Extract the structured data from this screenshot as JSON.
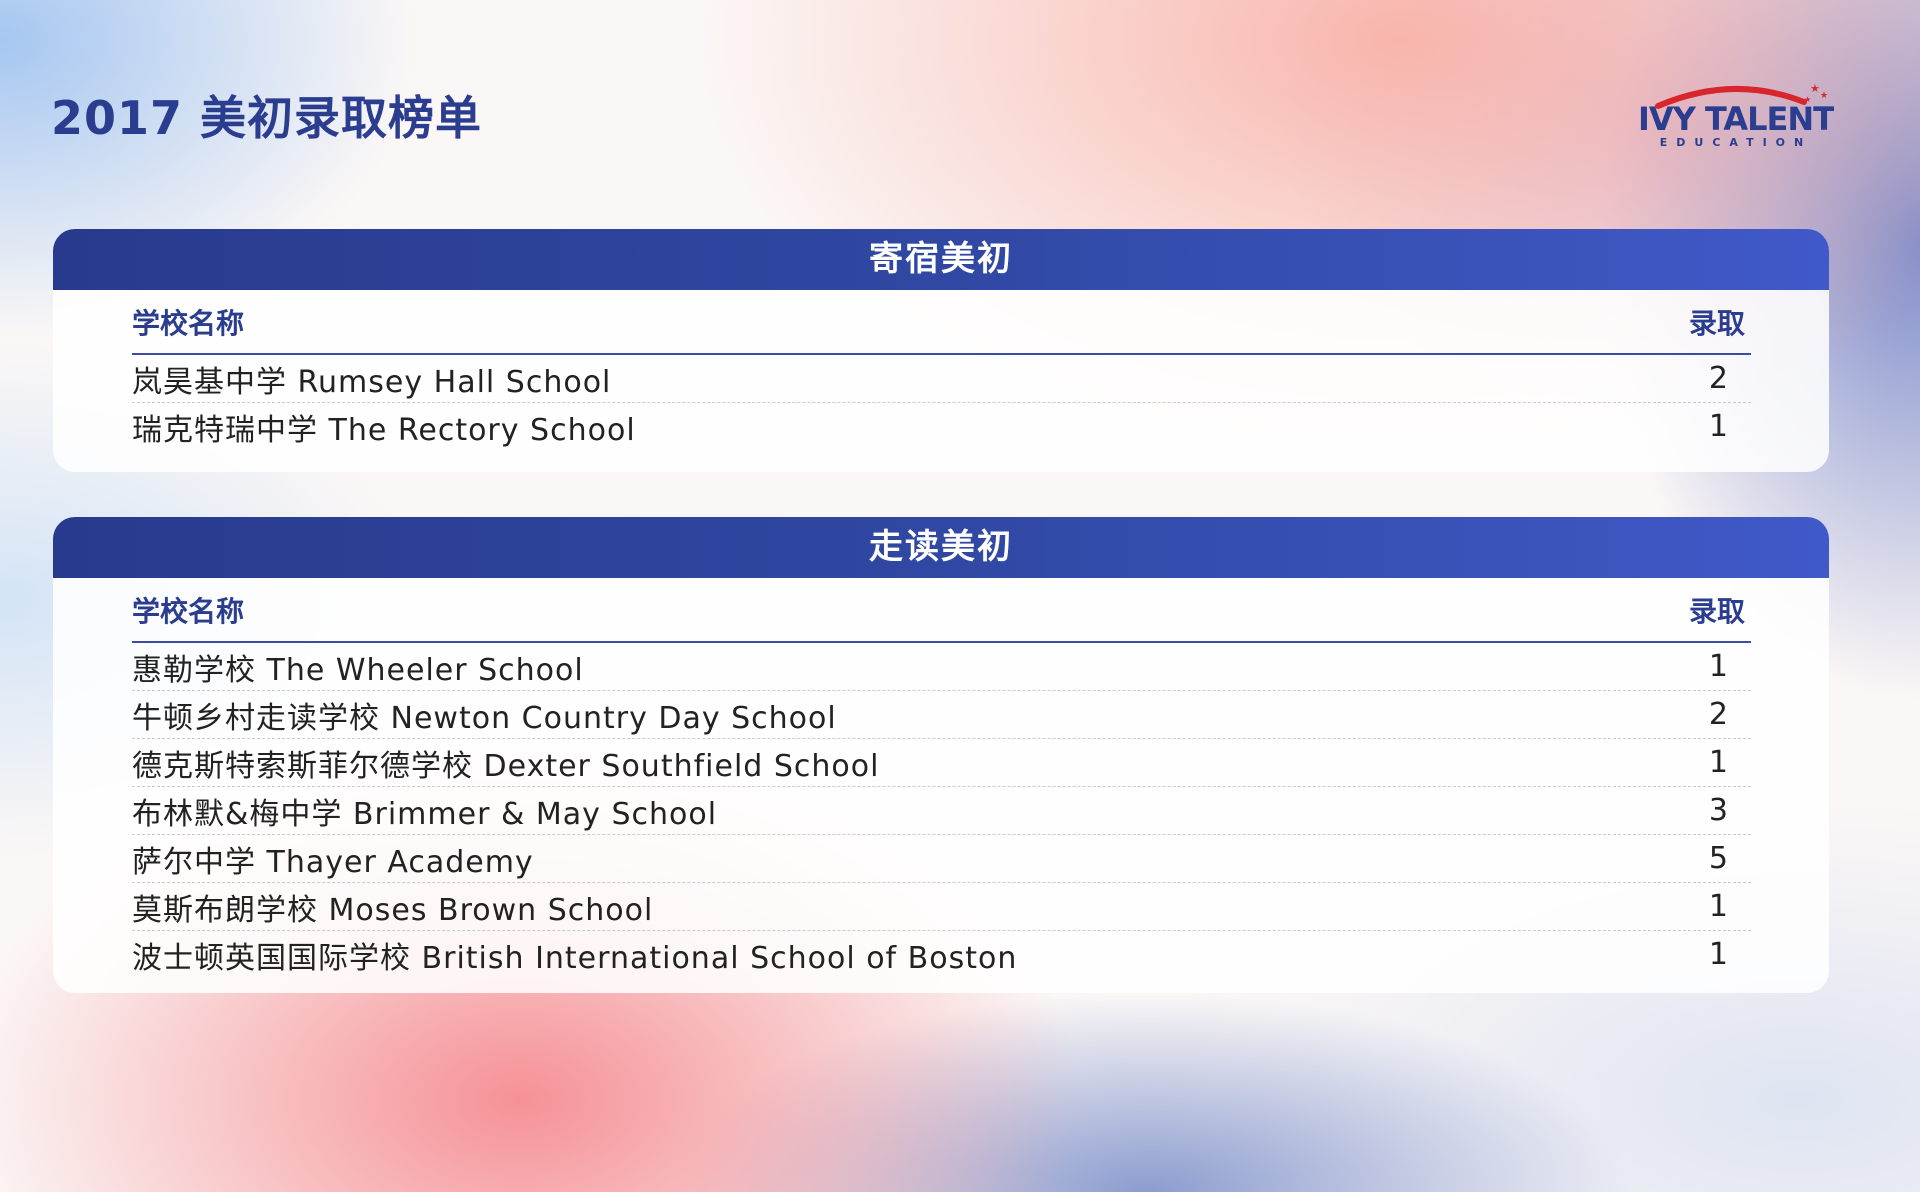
{
  "title": "2017 美初录取榜单",
  "logo": {
    "line1": "IVY TALENT",
    "line2": "EDUCATION"
  },
  "colors": {
    "brand_navy": "#2b3d8f",
    "header_start": "#283a8d",
    "header_end": "#4059c8",
    "logo_red": "#d8262c"
  },
  "sections": [
    {
      "title": "寄宿美初",
      "col_school": "学校名称",
      "col_count": "录取",
      "rows": [
        {
          "school": "岚昊基中学 Rumsey Hall School",
          "count": "2"
        },
        {
          "school": "瑞克特瑞中学 The Rectory School",
          "count": "1"
        }
      ]
    },
    {
      "title": "走读美初",
      "col_school": "学校名称",
      "col_count": "录取",
      "rows": [
        {
          "school": "惠勒学校 The Wheeler School",
          "count": "1"
        },
        {
          "school": "牛顿乡村走读学校 Newton Country Day School",
          "count": "2"
        },
        {
          "school": "德克斯特索斯菲尔德学校 Dexter Southfield School",
          "count": "1"
        },
        {
          "school": "布林默&梅中学 Brimmer & May School",
          "count": "3"
        },
        {
          "school": "萨尔中学 Thayer Academy",
          "count": "5"
        },
        {
          "school": "莫斯布朗学校 Moses Brown School",
          "count": "1"
        },
        {
          "school": "波士顿英国国际学校 British International School of Boston",
          "count": "1"
        }
      ]
    }
  ]
}
